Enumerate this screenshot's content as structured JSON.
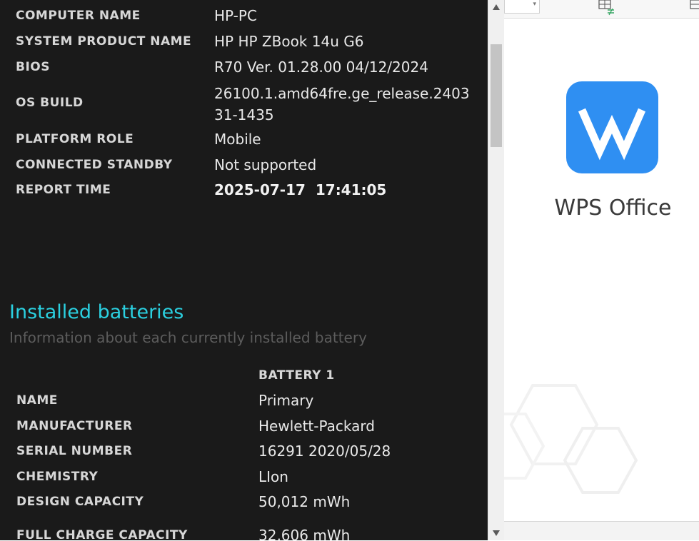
{
  "system_info": {
    "rows": [
      {
        "label": "COMPUTER NAME",
        "value": "HP-PC"
      },
      {
        "label": "SYSTEM PRODUCT NAME",
        "value": "HP HP ZBook 14u G6"
      },
      {
        "label": "BIOS",
        "value": "R70 Ver. 01.28.00 04/12/2024"
      },
      {
        "label": "OS BUILD",
        "value": "26100.1.amd64fre.ge_release.240331-1435"
      },
      {
        "label": "PLATFORM ROLE",
        "value": "Mobile"
      },
      {
        "label": "CONNECTED STANDBY",
        "value": "Not supported"
      },
      {
        "label": "REPORT TIME",
        "value": "2025-07-17  17:41:05"
      }
    ]
  },
  "batteries": {
    "title": "Installed batteries",
    "subtitle": "Information about each currently installed battery",
    "column_header": "BATTERY 1",
    "rows": [
      {
        "label": "NAME",
        "value": "Primary"
      },
      {
        "label": "MANUFACTURER",
        "value": "Hewlett-Packard"
      },
      {
        "label": "SERIAL NUMBER",
        "value": "16291 2020/05/28"
      },
      {
        "label": "CHEMISTRY",
        "value": "LIon"
      },
      {
        "label": "DESIGN CAPACITY",
        "value": "50,012 mWh"
      },
      {
        "label": "FULL CHARGE CAPACITY",
        "value": "32,606 mWh"
      }
    ]
  },
  "scrollbar": {
    "up_icon": "triangle-up",
    "down_icon": "triangle-down"
  },
  "wps": {
    "title": "WPS Office",
    "logo_color": "#2f8ff2"
  },
  "colors": {
    "accent": "#2bd0e0",
    "background": "#1a1a1a"
  }
}
